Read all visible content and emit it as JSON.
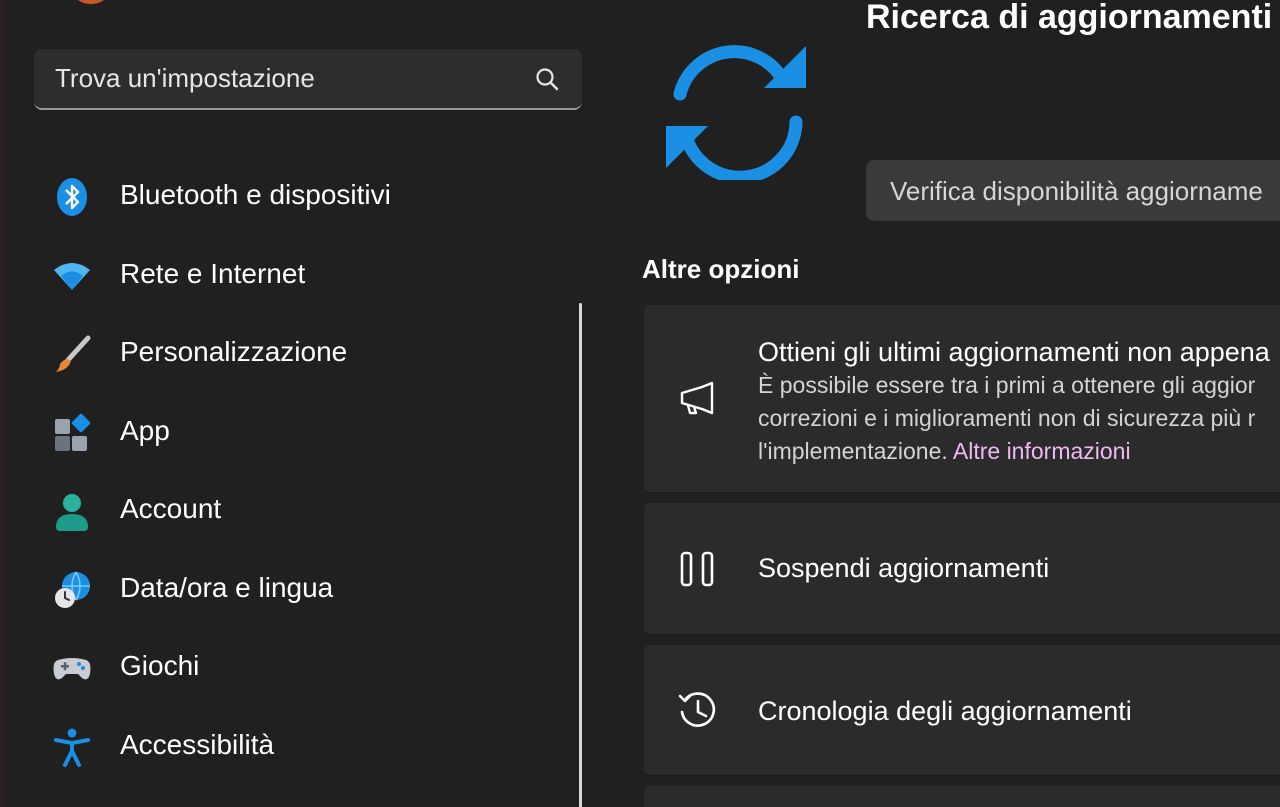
{
  "search": {
    "placeholder": "Trova un'impostazione",
    "icon": "search-icon"
  },
  "sidebar": {
    "items": [
      {
        "label": "Bluetooth e dispositivi",
        "icon": "bluetooth-icon"
      },
      {
        "label": "Rete e Internet",
        "icon": "wifi-icon"
      },
      {
        "label": "Personalizzazione",
        "icon": "paintbrush-icon"
      },
      {
        "label": "App",
        "icon": "apps-icon"
      },
      {
        "label": "Account",
        "icon": "account-icon"
      },
      {
        "label": "Data/ora e lingua",
        "icon": "time-language-icon"
      },
      {
        "label": "Giochi",
        "icon": "gamepad-icon"
      },
      {
        "label": "Accessibilità",
        "icon": "accessibility-icon"
      }
    ]
  },
  "main": {
    "title": "Ricerca di aggiornamenti i",
    "check_button": "Verifica disponibilità aggiorname",
    "section_title": "Altre opzioni",
    "cards": [
      {
        "icon": "megaphone-icon",
        "title": "Ottieni gli ultimi aggiornamenti non appena",
        "desc_line1": "È possibile essere tra i primi a ottenere gli aggior",
        "desc_line2": "correzioni e i miglioramenti non di sicurezza più r",
        "desc_line3": "l'implementazione.",
        "link": "Altre informazioni"
      },
      {
        "icon": "pause-icon",
        "title": "Sospendi aggiornamenti"
      },
      {
        "icon": "history-icon",
        "title": "Cronologia degli aggiornamenti"
      }
    ]
  },
  "colors": {
    "background": "#202020",
    "card": "#2b2b2b",
    "accent_blue": "#1a8fe3",
    "link": "#f0b8f4"
  }
}
